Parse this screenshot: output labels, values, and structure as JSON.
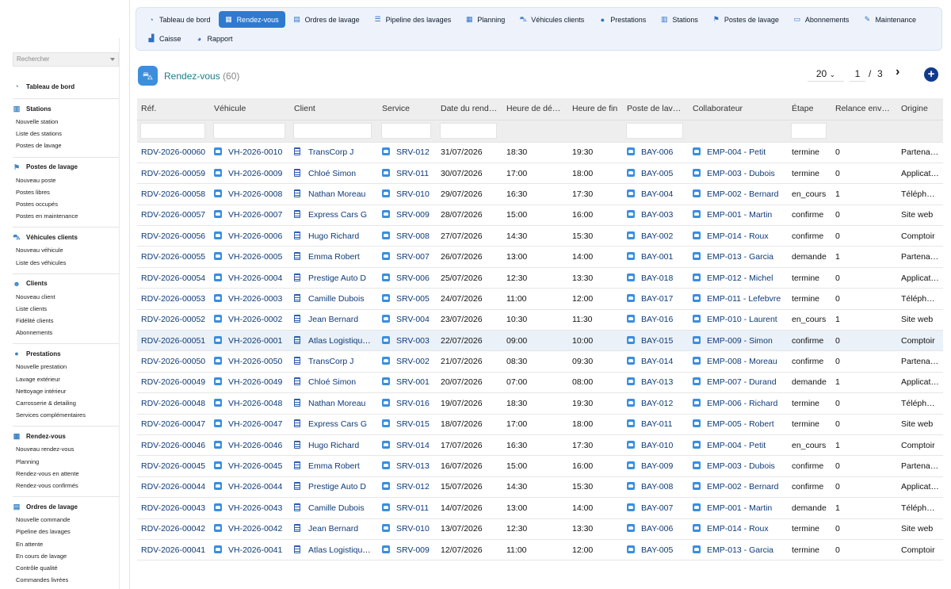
{
  "sidebar": {
    "search_placeholder": "Rechercher",
    "groups": [
      {
        "title": "Tableau de bord",
        "icon": "dashboard-icon",
        "items": []
      },
      {
        "title": "Stations",
        "icon": "building-icon",
        "items": [
          "Nouvelle station",
          "Liste des stations",
          "Postes de lavage"
        ]
      },
      {
        "title": "Postes de lavage",
        "icon": "flag-icon",
        "items": [
          "Nouveau poste",
          "Postes libres",
          "Postes occupés",
          "Postes en maintenance"
        ]
      },
      {
        "title": "Véhicules clients",
        "icon": "car-icon",
        "items": [
          "Nouveau véhicule",
          "Liste des véhicules"
        ]
      },
      {
        "title": "Clients",
        "icon": "users-icon",
        "items": [
          "Nouveau client",
          "Liste clients",
          "Fidélité clients",
          "Abonnements"
        ]
      },
      {
        "title": "Prestations",
        "icon": "drop-icon",
        "items": [
          "Nouvelle prestation",
          "Lavage extérieur",
          "Nettoyage intérieur",
          "Carrosserie & detailing",
          "Services complémentaires"
        ]
      },
      {
        "title": "Rendez-vous",
        "icon": "calendar-icon",
        "items": [
          "Nouveau rendez-vous",
          "Planning",
          "Rendez-vous en attente",
          "Rendez-vous confirmés"
        ]
      },
      {
        "title": "Ordres de lavage",
        "icon": "clipboard-icon",
        "items": [
          "Nouvelle commande",
          "Pipeline des lavages",
          "En attente",
          "En cours de lavage",
          "Contrôle qualité",
          "Commandes livrées"
        ]
      }
    ]
  },
  "topnav": {
    "row1": [
      {
        "label": "Tableau de bord",
        "icon": "dashboard-icon",
        "glyph": "◔",
        "active": false
      },
      {
        "label": "Rendez-vous",
        "icon": "calendar-icon",
        "glyph": "▦",
        "active": true
      },
      {
        "label": "Ordres de lavage",
        "icon": "clipboard-icon",
        "glyph": "▤",
        "active": false
      },
      {
        "label": "Pipeline des lavages",
        "icon": "list-icon",
        "glyph": "☰",
        "active": false
      },
      {
        "label": "Planning",
        "icon": "calendar-icon",
        "glyph": "▦",
        "active": false
      },
      {
        "label": "Véhicules clients",
        "icon": "car-icon",
        "glyph": "⛍",
        "active": false
      },
      {
        "label": "Prestations",
        "icon": "drop-icon",
        "glyph": "●",
        "active": false
      },
      {
        "label": "Stations",
        "icon": "building-icon",
        "glyph": "▥",
        "active": false
      },
      {
        "label": "Postes de lavage",
        "icon": "flag-icon",
        "glyph": "⚑",
        "active": false
      },
      {
        "label": "Abonnements",
        "icon": "card-icon",
        "glyph": "▭",
        "active": false
      },
      {
        "label": "Maintenance",
        "icon": "wrench-icon",
        "glyph": "✎",
        "active": false
      }
    ],
    "row2": [
      {
        "label": "Caisse",
        "icon": "cash-register-icon",
        "glyph": "▟",
        "active": false
      },
      {
        "label": "Rapport",
        "icon": "pie-chart-icon",
        "glyph": "◕",
        "active": false
      }
    ]
  },
  "page": {
    "title": "Rendez-vous",
    "count": "(60)",
    "page_size": "20",
    "current_page": "1",
    "separator": "/",
    "total_pages": "3"
  },
  "table": {
    "columns": [
      "Réf.",
      "Véhicule",
      "Client",
      "Service",
      "Date du rend…",
      "Heure de dé…",
      "Heure de fin",
      "Poste de lav…",
      "Collaborateur",
      "Étape",
      "Relance env…",
      "Origine"
    ],
    "filter_columns": [
      true,
      true,
      true,
      true,
      true,
      false,
      false,
      true,
      false,
      true,
      false,
      false
    ],
    "rows": [
      [
        "RDV-2026-00060",
        "VH-2026-0010",
        "TransCorp J",
        "SRV-012",
        "31/07/2026",
        "18:30",
        "19:30",
        "BAY-006",
        "EMP-004 - Petit",
        "termine",
        "0",
        "Partenaire"
      ],
      [
        "RDV-2026-00059",
        "VH-2026-0009",
        "Chloé Simon",
        "SRV-011",
        "30/07/2026",
        "17:00",
        "18:00",
        "BAY-005",
        "EMP-003 - Dubois",
        "termine",
        "0",
        "Application"
      ],
      [
        "RDV-2026-00058",
        "VH-2026-0008",
        "Nathan Moreau",
        "SRV-010",
        "29/07/2026",
        "16:30",
        "17:30",
        "BAY-004",
        "EMP-002 - Bernard",
        "en_cours",
        "1",
        "Téléphone"
      ],
      [
        "RDV-2026-00057",
        "VH-2026-0007",
        "Express Cars G",
        "SRV-009",
        "28/07/2026",
        "15:00",
        "16:00",
        "BAY-003",
        "EMP-001 - Martin",
        "confirme",
        "0",
        "Site web"
      ],
      [
        "RDV-2026-00056",
        "VH-2026-0006",
        "Hugo Richard",
        "SRV-008",
        "27/07/2026",
        "14:30",
        "15:30",
        "BAY-002",
        "EMP-014 - Roux",
        "confirme",
        "0",
        "Comptoir"
      ],
      [
        "RDV-2026-00055",
        "VH-2026-0005",
        "Emma Robert",
        "SRV-007",
        "26/07/2026",
        "13:00",
        "14:00",
        "BAY-001",
        "EMP-013 - Garcia",
        "demande",
        "1",
        "Partenaire"
      ],
      [
        "RDV-2026-00054",
        "VH-2026-0004",
        "Prestige Auto D",
        "SRV-006",
        "25/07/2026",
        "12:30",
        "13:30",
        "BAY-018",
        "EMP-012 - Michel",
        "termine",
        "0",
        "Application"
      ],
      [
        "RDV-2026-00053",
        "VH-2026-0003",
        "Camille Dubois",
        "SRV-005",
        "24/07/2026",
        "11:00",
        "12:00",
        "BAY-017",
        "EMP-011 - Lefebvre",
        "termine",
        "0",
        "Téléphone"
      ],
      [
        "RDV-2026-00052",
        "VH-2026-0002",
        "Jean Bernard",
        "SRV-004",
        "23/07/2026",
        "10:30",
        "11:30",
        "BAY-016",
        "EMP-010 - Laurent",
        "en_cours",
        "1",
        "Site web"
      ],
      [
        "RDV-2026-00051",
        "VH-2026-0001",
        "Atlas Logistique A",
        "SRV-003",
        "22/07/2026",
        "09:00",
        "10:00",
        "BAY-015",
        "EMP-009 - Simon",
        "confirme",
        "0",
        "Comptoir"
      ],
      [
        "RDV-2026-00050",
        "VH-2026-0050",
        "TransCorp J",
        "SRV-002",
        "21/07/2026",
        "08:30",
        "09:30",
        "BAY-014",
        "EMP-008 - Moreau",
        "confirme",
        "0",
        "Partenaire"
      ],
      [
        "RDV-2026-00049",
        "VH-2026-0049",
        "Chloé Simon",
        "SRV-001",
        "20/07/2026",
        "07:00",
        "08:00",
        "BAY-013",
        "EMP-007 - Durand",
        "demande",
        "1",
        "Application"
      ],
      [
        "RDV-2026-00048",
        "VH-2026-0048",
        "Nathan Moreau",
        "SRV-016",
        "19/07/2026",
        "18:30",
        "19:30",
        "BAY-012",
        "EMP-006 - Richard",
        "termine",
        "0",
        "Téléphone"
      ],
      [
        "RDV-2026-00047",
        "VH-2026-0047",
        "Express Cars G",
        "SRV-015",
        "18/07/2026",
        "17:00",
        "18:00",
        "BAY-011",
        "EMP-005 - Robert",
        "termine",
        "0",
        "Site web"
      ],
      [
        "RDV-2026-00046",
        "VH-2026-0046",
        "Hugo Richard",
        "SRV-014",
        "17/07/2026",
        "16:30",
        "17:30",
        "BAY-010",
        "EMP-004 - Petit",
        "en_cours",
        "1",
        "Comptoir"
      ],
      [
        "RDV-2026-00045",
        "VH-2026-0045",
        "Emma Robert",
        "SRV-013",
        "16/07/2026",
        "15:00",
        "16:00",
        "BAY-009",
        "EMP-003 - Dubois",
        "confirme",
        "0",
        "Partenaire"
      ],
      [
        "RDV-2026-00044",
        "VH-2026-0044",
        "Prestige Auto D",
        "SRV-012",
        "15/07/2026",
        "14:30",
        "15:30",
        "BAY-008",
        "EMP-002 - Bernard",
        "confirme",
        "0",
        "Application"
      ],
      [
        "RDV-2026-00043",
        "VH-2026-0043",
        "Camille Dubois",
        "SRV-011",
        "14/07/2026",
        "13:00",
        "14:00",
        "BAY-007",
        "EMP-001 - Martin",
        "demande",
        "1",
        "Téléphone"
      ],
      [
        "RDV-2026-00042",
        "VH-2026-0042",
        "Jean Bernard",
        "SRV-010",
        "13/07/2026",
        "12:30",
        "13:30",
        "BAY-006",
        "EMP-014 - Roux",
        "termine",
        "0",
        "Site web"
      ],
      [
        "RDV-2026-00041",
        "VH-2026-0041",
        "Atlas Logistique A",
        "SRV-009",
        "12/07/2026",
        "11:00",
        "12:00",
        "BAY-005",
        "EMP-013 - Garcia",
        "termine",
        "0",
        "Comptoir"
      ]
    ],
    "highlighted_row": 9
  },
  "colors": {
    "accent": "#2f7ad1",
    "title": "#1f7a8c",
    "link": "#0d3a78",
    "row_highlight": "#eaf1f8"
  }
}
